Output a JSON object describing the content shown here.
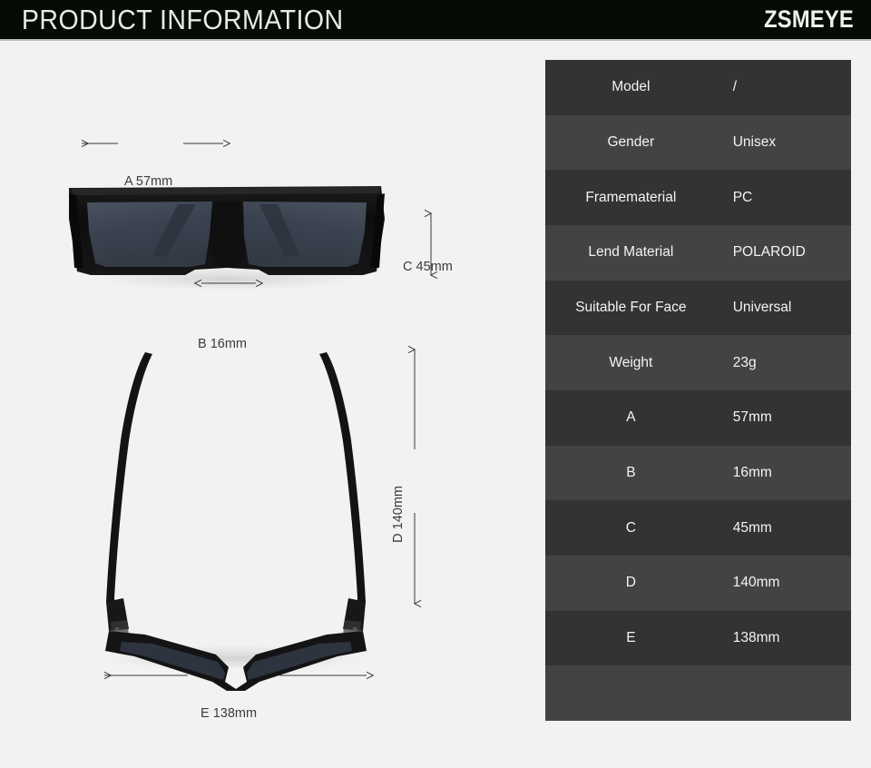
{
  "header": {
    "title": "PRODUCT INFORMATION",
    "brand": "ZSMEYE",
    "bar_color": "#050c06",
    "text_color": "#e9eae7"
  },
  "spec_table": {
    "row_colors": {
      "odd": "#333333",
      "even": "#434343"
    },
    "text_color": "#f4f4f4",
    "rows": [
      {
        "label": "Model",
        "value": "/"
      },
      {
        "label": "Gender",
        "value": "Unisex"
      },
      {
        "label": "Framematerial",
        "value": "PC"
      },
      {
        "label": "Lend Material",
        "value": "POLAROID"
      },
      {
        "label": "Suitable For Face",
        "value": "Universal"
      },
      {
        "label": "Weight",
        "value": "23g"
      },
      {
        "label": "A",
        "value": "57mm"
      },
      {
        "label": "B",
        "value": "16mm"
      },
      {
        "label": "C",
        "value": "45mm"
      },
      {
        "label": "D",
        "value": "140mm"
      },
      {
        "label": "E",
        "value": "138mm"
      },
      {
        "label": "",
        "value": ""
      }
    ]
  },
  "diagram": {
    "front_view_caption": "front view of black square sunglasses",
    "top_view_caption": "top-down view of black square sunglasses",
    "measurements": {
      "a": "A 57mm",
      "b": "B 16mm",
      "c": "C 45mm",
      "d": "D 140mm",
      "e": "E 138mm"
    },
    "frame_color": "#121212",
    "lens_color": "#3c4450",
    "background_color": "#f2f2f1"
  }
}
